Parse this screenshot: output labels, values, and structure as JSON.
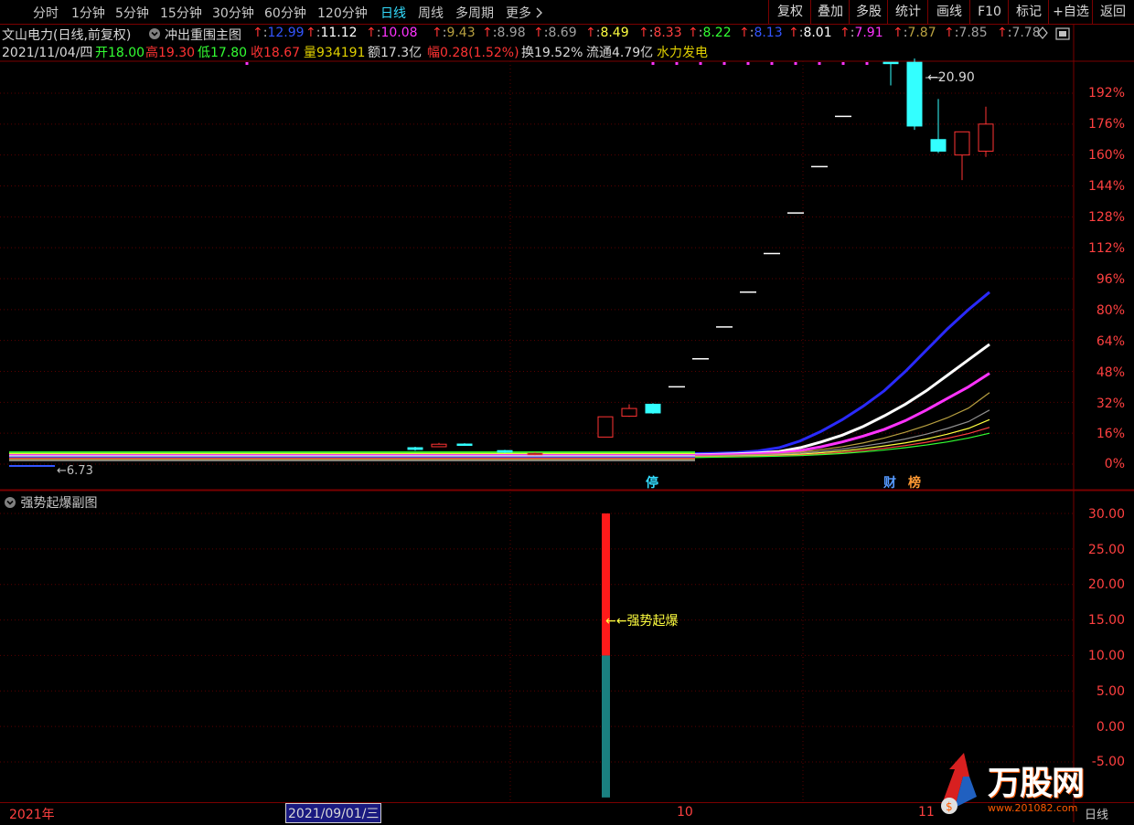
{
  "toolbar": {
    "left_tabs": [
      {
        "label": "分时"
      },
      {
        "label": "1分钟"
      },
      {
        "label": "5分钟"
      },
      {
        "label": "15分钟"
      },
      {
        "label": "30分钟"
      },
      {
        "label": "60分钟"
      },
      {
        "label": "120分钟"
      },
      {
        "label": "日线"
      },
      {
        "label": "周线"
      },
      {
        "label": "多周期"
      },
      {
        "label": "更多"
      }
    ],
    "active_tab": "日线",
    "more_icon": "chevron-right-icon",
    "right_buttons": [
      {
        "label": "复权"
      },
      {
        "label": "叠加"
      },
      {
        "label": "多股"
      },
      {
        "label": "统计"
      },
      {
        "label": "画线"
      },
      {
        "label": "F10"
      },
      {
        "label": "标记"
      },
      {
        "label": "+自选"
      },
      {
        "label": "返回"
      }
    ]
  },
  "header": {
    "stock_title": "文山电力(日线,前复权)",
    "indicator_name": "冲出重围主图",
    "ma_values": [
      {
        "text": "12.99",
        "color": "#3355ff"
      },
      {
        "text": "11.12",
        "color": "#ffffff"
      },
      {
        "text": "10.08",
        "color": "#ff33ff"
      },
      {
        "text": "9.43",
        "color": "#b8a040"
      },
      {
        "text": "8.98",
        "color": "#a0a0a0"
      },
      {
        "text": "8.69",
        "color": "#a0a0a0"
      },
      {
        "text": "8.49",
        "color": "#ffff40"
      },
      {
        "text": "8.33",
        "color": "#ff4040"
      },
      {
        "text": "8.22",
        "color": "#33ff33"
      },
      {
        "text": "8.13",
        "color": "#3355ff"
      },
      {
        "text": "8.01",
        "color": "#ffffff"
      },
      {
        "text": "7.91",
        "color": "#ff33ff"
      },
      {
        "text": "7.87",
        "color": "#b8a040"
      },
      {
        "text": "7.85",
        "color": "#a0a0a0"
      },
      {
        "text": "7.78",
        "color": "#a0a0a0"
      }
    ],
    "diamond_icon": "diamond-icon"
  },
  "quote": {
    "date": "2021/11/04/四",
    "open_label": "开18.00",
    "high_label": "高19.30",
    "low_label": "低17.80",
    "close_label": "收18.67",
    "volume_label": "量934191",
    "amount_label": "额17.3亿",
    "range_label": "幅0.28(1.52%)",
    "turnover_label": "换19.52%",
    "float_label": "流通4.79亿",
    "sector": "水力发电"
  },
  "main_axis": {
    "labels": [
      "192%",
      "176%",
      "160%",
      "144%",
      "128%",
      "112%",
      "96%",
      "80%",
      "64%",
      "48%",
      "32%",
      "16%",
      "0%"
    ]
  },
  "annotations": {
    "high_price": "20.90",
    "low_price": "6.73",
    "limit_badge": "停",
    "finance_badge": "财",
    "rank_badge": "榜"
  },
  "sub_panel": {
    "title": "强势起爆副图",
    "signal_label": "强势起爆",
    "axis_labels": [
      "30.00",
      "25.00",
      "20.00",
      "15.00",
      "10.00",
      "5.00",
      "0.00",
      "-5.00"
    ]
  },
  "bottom": {
    "year_label": "2021年",
    "cursor_date": "2021/09/01/三",
    "month_10": "10",
    "month_11": "11",
    "period_label": "日线"
  },
  "watermark": {
    "brand": "万股网",
    "url": "www.201082.com"
  },
  "colors": {
    "up": "#ff3333",
    "down": "#33ffff",
    "grid": "#7a0000",
    "signal_red": "#ff1a1a",
    "signal_teal": "#1a8080"
  },
  "chart_data": {
    "type": "candlestick",
    "y_axis": "percent change",
    "ylim": [
      -6,
      208
    ],
    "candles": [
      {
        "o": 8.5,
        "c": 7.6,
        "h": 9.0,
        "l": 7.0
      },
      {
        "o": 9.0,
        "c": 10.3,
        "h": 11.0,
        "l": 8.8
      },
      {
        "o": 10.4,
        "c": 9.7,
        "h": 10.8,
        "l": 9.5
      },
      {
        "o": 7.0,
        "c": 6.2,
        "h": 7.4,
        "l": 5.8
      },
      {
        "o": 5.0,
        "c": 5.6,
        "h": 6.2,
        "l": 4.6
      },
      {
        "o": 14.0,
        "c": 24.5,
        "h": 24.5,
        "l": 14.0
      },
      {
        "o": 24.8,
        "c": 28.8,
        "h": 31.0,
        "l": 24.5
      },
      {
        "o": 31.0,
        "c": 26.5,
        "h": 31.5,
        "l": 26.0
      },
      {
        "o": 40.0,
        "c": 40.0,
        "h": 40.0,
        "l": 40.0
      },
      {
        "o": 54.5,
        "c": 54.5,
        "h": 54.5,
        "l": 54.5
      },
      {
        "o": 71.0,
        "c": 71.0,
        "h": 71.0,
        "l": 71.0
      },
      {
        "o": 89.0,
        "c": 89.0,
        "h": 89.0,
        "l": 89.0
      },
      {
        "o": 109.0,
        "c": 109.0,
        "h": 109.0,
        "l": 109.0
      },
      {
        "o": 130.0,
        "c": 130.0,
        "h": 130.0,
        "l": 130.0
      },
      {
        "o": 154.0,
        "c": 154.0,
        "h": 154.0,
        "l": 154.0
      },
      {
        "o": 180.0,
        "c": 180.0,
        "h": 180.0,
        "l": 180.0
      },
      {
        "o": 208.0,
        "c": 208.0,
        "h": 208.0,
        "l": 196.0
      },
      {
        "o": 208.0,
        "c": 175.0,
        "h": 210.0,
        "l": 173.0
      },
      {
        "o": 168.0,
        "c": 162.0,
        "h": 189.0,
        "l": 161.0
      },
      {
        "o": 160.0,
        "c": 172.0,
        "h": 172.0,
        "l": 147.0
      },
      {
        "o": 162.0,
        "c": 176.0,
        "h": 185.0,
        "l": 159.0
      }
    ],
    "series": [
      {
        "values": [
          5.4,
          5.6,
          6.0,
          6.8,
          8.5,
          12.0,
          17.0,
          23.0,
          30.0,
          38.0,
          48.0,
          59.0,
          70.0,
          80.0,
          89.0
        ],
        "color": "#2a2aff"
      },
      {
        "values": [
          4.8,
          5.0,
          5.3,
          5.8,
          6.5,
          8.5,
          11.5,
          15.0,
          19.5,
          25.0,
          31.0,
          38.0,
          46.0,
          54.0,
          62.0
        ],
        "color": "#ffffff"
      },
      {
        "values": [
          4.5,
          4.7,
          4.9,
          5.3,
          5.8,
          7.0,
          9.0,
          11.5,
          14.5,
          18.0,
          22.5,
          28.0,
          34.0,
          40.0,
          47.0
        ],
        "color": "#ff33ff"
      },
      {
        "values": [
          4.2,
          4.4,
          4.6,
          4.9,
          5.3,
          6.2,
          7.5,
          9.0,
          11.0,
          13.5,
          16.5,
          20.0,
          24.0,
          29.0,
          37.0
        ],
        "color": "#b8a040"
      },
      {
        "values": [
          4.0,
          4.2,
          4.4,
          4.6,
          5.0,
          5.6,
          6.6,
          7.8,
          9.3,
          11.0,
          13.0,
          15.5,
          18.5,
          22.0,
          28.0
        ],
        "color": "#909090"
      },
      {
        "values": [
          3.8,
          4.0,
          4.1,
          4.3,
          4.6,
          5.1,
          5.9,
          6.8,
          8.0,
          9.4,
          11.0,
          13.0,
          15.5,
          18.5,
          23.0
        ],
        "color": "#ffff40"
      },
      {
        "values": [
          3.6,
          3.8,
          3.9,
          4.1,
          4.3,
          4.7,
          5.3,
          6.0,
          7.0,
          8.2,
          9.6,
          11.3,
          13.4,
          15.8,
          19.0
        ],
        "color": "#ff4040"
      },
      {
        "values": [
          3.4,
          3.6,
          3.7,
          3.9,
          4.1,
          4.4,
          4.9,
          5.5,
          6.3,
          7.3,
          8.5,
          9.9,
          11.5,
          13.5,
          16.0
        ],
        "color": "#33ff33"
      }
    ],
    "sub": {
      "type": "bar",
      "ylim": [
        -10,
        32
      ],
      "teal_from": -10,
      "teal_to": 10,
      "red_from": 10,
      "red_to": 30
    }
  }
}
